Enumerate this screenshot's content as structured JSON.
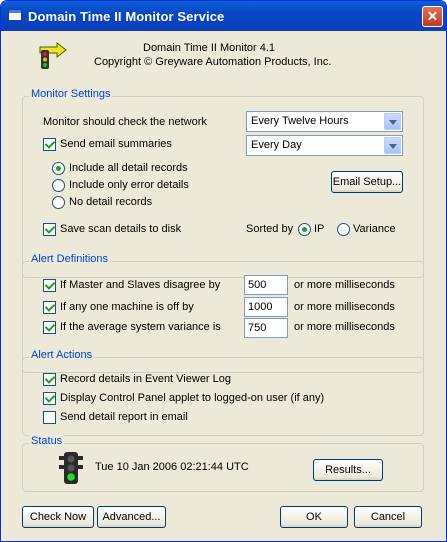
{
  "window": {
    "title": "Domain Time II Monitor Service",
    "close_glyph": "✕"
  },
  "header": {
    "app_name": "Domain Time II Monitor 4.1",
    "copyright": "Copyright © Greyware Automation Products, Inc.",
    "logo_icon": "traffic-light-arrow-logo"
  },
  "monitor_settings": {
    "legend": "Monitor Settings",
    "check_network_label": "Monitor should check the network",
    "check_network_value": "Every Twelve Hours",
    "send_email_label": "Send email summaries",
    "send_email_checked": true,
    "email_frequency_value": "Every Day",
    "detail_options": [
      {
        "label": "Include all detail records",
        "selected": true
      },
      {
        "label": "Include only error details",
        "selected": false
      },
      {
        "label": "No detail records",
        "selected": false
      }
    ],
    "email_setup_label": "Email Setup...",
    "save_scan_label": "Save scan details to disk",
    "save_scan_checked": true,
    "sorted_by_label": "Sorted by",
    "sort_options": [
      {
        "label": "IP",
        "selected": true
      },
      {
        "label": "Variance",
        "selected": false
      }
    ]
  },
  "alert_definitions": {
    "legend": "Alert Definitions",
    "rows": [
      {
        "label": "If Master and Slaves disagree by",
        "checked": true,
        "value": "500",
        "suffix": "or more milliseconds"
      },
      {
        "label": "If any one machine is off by",
        "checked": true,
        "value": "1000",
        "suffix": "or more milliseconds"
      },
      {
        "label": "If the average system variance is",
        "checked": true,
        "value": "750",
        "suffix": "or more milliseconds"
      }
    ]
  },
  "alert_actions": {
    "legend": "Alert Actions",
    "items": [
      {
        "label": "Record details in Event Viewer Log",
        "checked": true
      },
      {
        "label": "Display Control Panel applet to logged-on user (if any)",
        "checked": true
      },
      {
        "label": "Send detail report in email",
        "checked": false
      }
    ]
  },
  "status": {
    "legend": "Status",
    "icon": "traffic-light-green-icon",
    "timestamp": "Tue 10 Jan 2006 02:21:44 UTC",
    "results_label": "Results..."
  },
  "footer": {
    "check_now_label": "Check Now",
    "advanced_label": "Advanced...",
    "ok_label": "OK",
    "cancel_label": "Cancel"
  },
  "colors": {
    "titlebar": "#0a4fd0",
    "group_legend": "#0046d5",
    "dialog_bg": "#ece9d8",
    "check_mark": "#21a121"
  }
}
